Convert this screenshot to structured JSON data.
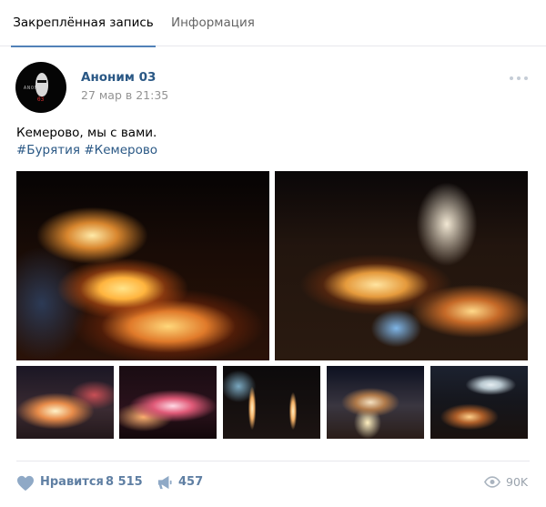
{
  "tabs": {
    "pinned": "Закреплённая запись",
    "info": "Информация"
  },
  "post": {
    "author": "Аноним 03",
    "date": "27 мар в 21:35",
    "avatar_text_top": "ANONIM",
    "avatar_text_bottom": "03",
    "text": "Кемерово, мы с вами.",
    "hashtags": [
      "#Бурятия",
      "#Кемерово"
    ],
    "photo_count": 7
  },
  "footer": {
    "like_label": "Нравится",
    "like_count": "8 515",
    "share_count": "457",
    "views_count": "90K"
  },
  "colors": {
    "accent": "#5181b8",
    "link": "#2a5885",
    "action": "#5f7fa3"
  }
}
